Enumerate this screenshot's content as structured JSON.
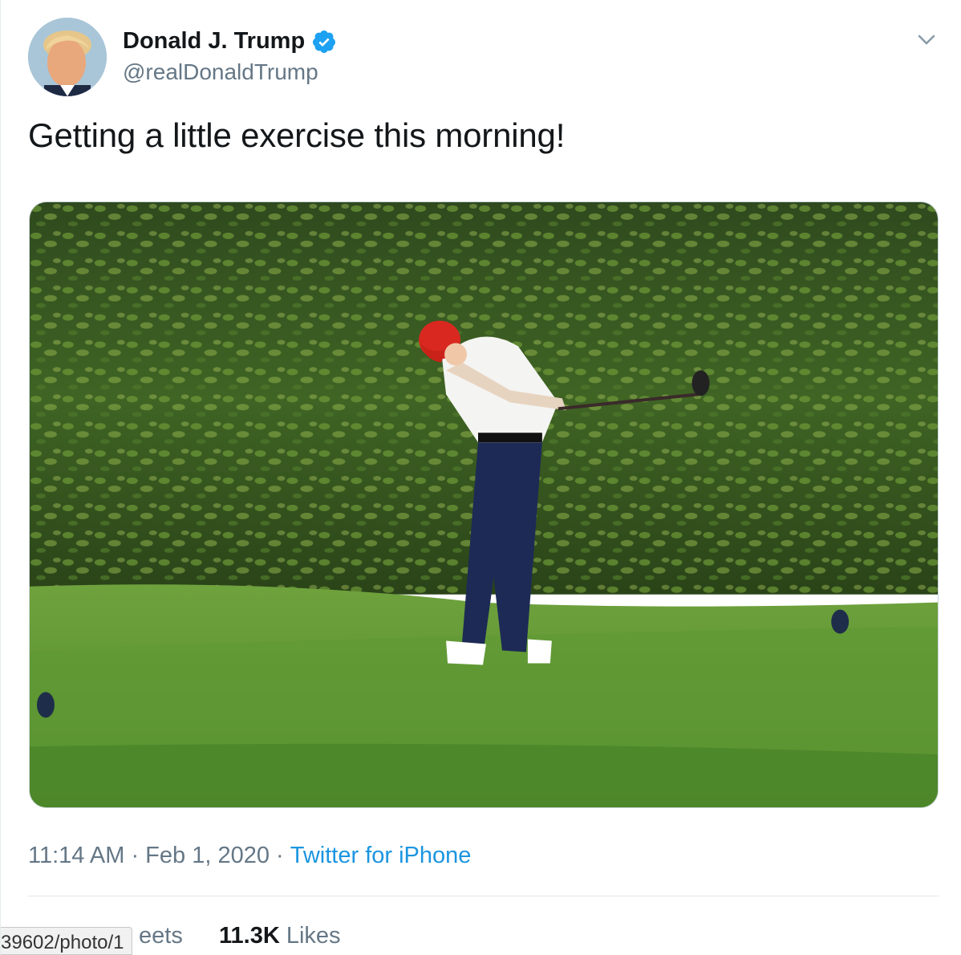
{
  "tweet": {
    "author": {
      "display_name": "Donald J. Trump",
      "handle": "@realDonaldTrump",
      "verified": true
    },
    "text": "Getting a little exercise this morning!",
    "time": "11:14 AM",
    "date": "Feb 1, 2020",
    "source": "Twitter for iPhone",
    "retweets_label_partial": "eets",
    "likes_count": "11.3K",
    "likes_label": "Likes"
  },
  "status_bar": {
    "url_fragment": "39602/photo/1"
  },
  "colors": {
    "link": "#1b95e0",
    "muted": "#657786",
    "verified": "#1da1f2"
  },
  "icons": {
    "verified": "verified-badge-icon",
    "menu": "chevron-down-icon"
  }
}
